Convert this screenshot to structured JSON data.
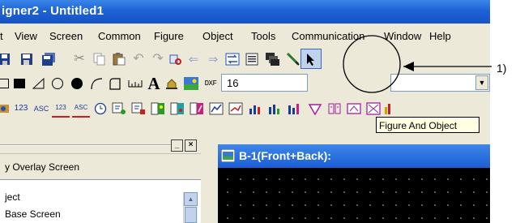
{
  "window": {
    "title": "igner2 - Untitled1"
  },
  "menu": [
    "t",
    "View",
    "Screen",
    "Common",
    "Figure",
    "Object",
    "Tools",
    "Communication",
    "Window",
    "Help"
  ],
  "toolbar2": {
    "text_icon": "A",
    "dxf_icon": "DXF",
    "font_size_value": "16"
  },
  "toolbar3": {
    "numeric_icon": "123",
    "ascii_icon": "ASC",
    "lamp_labels": [
      "123",
      "ASC"
    ]
  },
  "tooltip": {
    "text": "Figure And Object"
  },
  "callout": {
    "label": "1)"
  },
  "left_panel": {
    "tab_label": "y Overlay Screen",
    "items": [
      "ject",
      "Base Screen"
    ]
  },
  "screen_panel": {
    "title": "B-1(Front+Back):"
  },
  "colors": {
    "title_blue": "#1f62d6",
    "face": "#ece9d8",
    "tooltip_bg": "#ffffe1"
  }
}
